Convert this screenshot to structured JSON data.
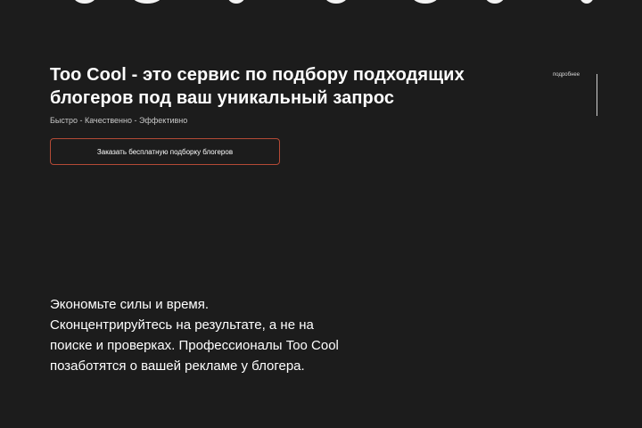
{
  "hero": {
    "title_line1": "Too Cool - это сервис по подбору подходящих",
    "title_line2": "блогеров под ваш уникальный запрос",
    "subtitle": "Быстро - Качественно - Эффективно",
    "cta_label": "Заказать бесплатную подборку блогеров"
  },
  "side": {
    "more_label": "подробнее"
  },
  "info": {
    "lines": [
      "Экономьте силы и время.",
      "Сконцентрируйтесь на результате, а не на",
      "поиске и проверках. Профессионалы Too Cool",
      "позаботятся о вашей рекламе у блогера."
    ]
  },
  "colors": {
    "background": "#1c1c1c",
    "text": "#ffffff",
    "button_border": "#b44a36"
  }
}
